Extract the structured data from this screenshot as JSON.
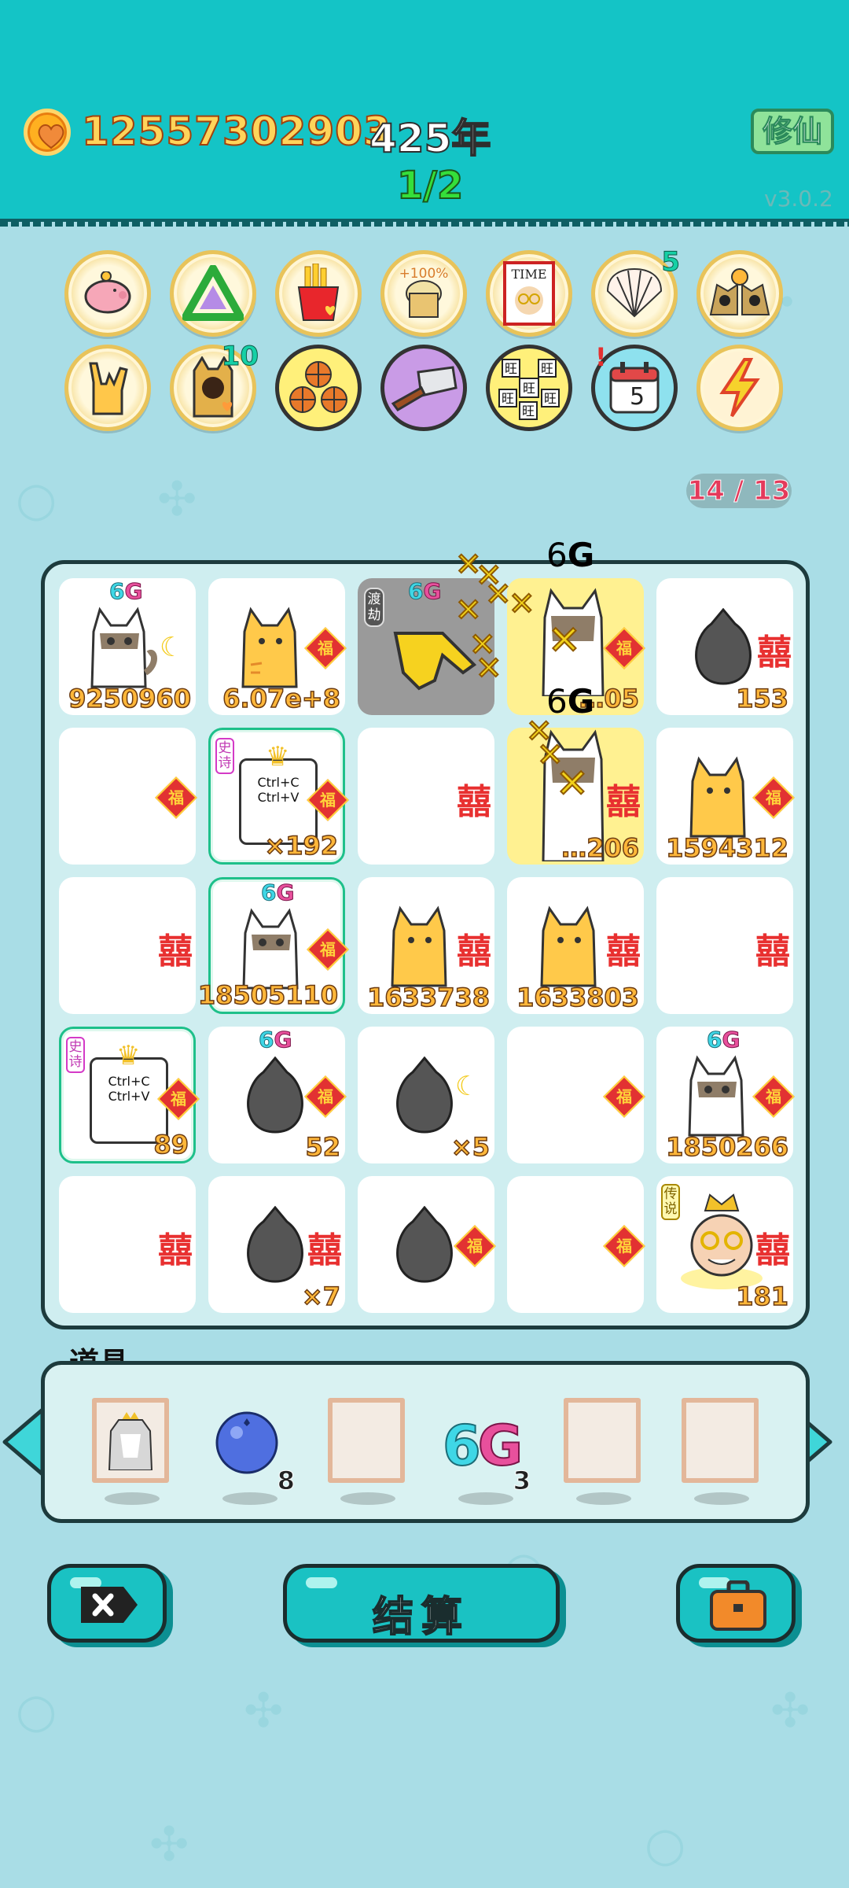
{
  "header": {
    "coins": "12557302903",
    "year": "425年",
    "round": "1/2",
    "cultivate_label": "修仙",
    "version": "v3.0.2"
  },
  "buffs": [
    {
      "name": "piggy-bank",
      "count": ""
    },
    {
      "name": "recycle",
      "count": ""
    },
    {
      "name": "fries",
      "count": ""
    },
    {
      "name": "bucket-plus-100",
      "label": "+100%",
      "count": ""
    },
    {
      "name": "time-magazine",
      "label": "TIME",
      "count": ""
    },
    {
      "name": "shell",
      "count": "5"
    },
    {
      "name": "golden-cats",
      "count": ""
    },
    {
      "name": "rock-hand",
      "count": ""
    },
    {
      "name": "cat-figure",
      "count": "10"
    },
    {
      "name": "basketballs",
      "count": ""
    },
    {
      "name": "cleaver",
      "count": ""
    },
    {
      "name": "wang-tiles",
      "label": "旺",
      "count": ""
    },
    {
      "name": "calendar",
      "label": "5",
      "count": "",
      "alert": "!"
    },
    {
      "name": "lightning",
      "count": ""
    }
  ],
  "counter": "14 / 13",
  "board": {
    "cells": [
      {
        "kind": "cat-white",
        "tag6g": true,
        "value": "9250960",
        "moon": true
      },
      {
        "kind": "cat-orange",
        "value": "6.07e+8",
        "fu": true
      },
      {
        "kind": "hand",
        "tag6g": true,
        "dujie": "渡劫",
        "gray": true
      },
      {
        "kind": "cat-white",
        "tag6g": true,
        "value": "…05",
        "yellow": true,
        "fu": true
      },
      {
        "kind": "trash",
        "value": "153",
        "xi": true
      },
      {
        "kind": "empty",
        "fu": true
      },
      {
        "kind": "ctrl",
        "epic": "史诗",
        "value": "×192",
        "fu": true
      },
      {
        "kind": "empty",
        "xi": true
      },
      {
        "kind": "cat-white",
        "tag6g": true,
        "value": "…206",
        "yellow": true,
        "xi": true
      },
      {
        "kind": "cat-orange",
        "value": "1594312",
        "fu": true
      },
      {
        "kind": "empty",
        "xi": true
      },
      {
        "kind": "cat-white",
        "tag6g": true,
        "value": "18505110",
        "epicframe": true,
        "fu": true
      },
      {
        "kind": "cat-orange",
        "value": "1633738",
        "xi": true
      },
      {
        "kind": "cat-orange",
        "value": "1633803",
        "xi": true
      },
      {
        "kind": "empty",
        "xi": true
      },
      {
        "kind": "ctrl",
        "epic": "史诗",
        "value": "89",
        "fu": true
      },
      {
        "kind": "trash",
        "tag6g": true,
        "value": "52",
        "fu": true
      },
      {
        "kind": "trash",
        "value": "×5",
        "moon": true
      },
      {
        "kind": "empty",
        "fu": true
      },
      {
        "kind": "cat-white",
        "tag6g": true,
        "value": "1850266",
        "fu": true
      },
      {
        "kind": "empty",
        "xi": true
      },
      {
        "kind": "trash",
        "value": "×7",
        "xi": true
      },
      {
        "kind": "trash",
        "fu": true
      },
      {
        "kind": "empty",
        "fu": true
      },
      {
        "kind": "grandpa",
        "legend": "传说",
        "value": "181",
        "xi": true
      }
    ],
    "ctrl_text": [
      "Ctrl+C",
      "Ctrl+V"
    ],
    "fu_char": "福",
    "xi_char": "囍",
    "tag6g_text": "6",
    "tag6g_g": "G"
  },
  "items": {
    "title": "道具",
    "list": [
      {
        "name": "husky-card",
        "count": ""
      },
      {
        "name": "blueberry",
        "count": "8"
      },
      {
        "name": "empty-frame",
        "count": ""
      },
      {
        "name": "6g",
        "label_6": "6",
        "label_g": "G",
        "count": "3"
      },
      {
        "name": "empty-frame",
        "count": ""
      },
      {
        "name": "empty-frame",
        "count": ""
      }
    ]
  },
  "buttons": {
    "settle_label": "结算"
  },
  "colors": {
    "header": "#14c4c6",
    "background": "#a9dde6",
    "gold_text": "#ffd45a",
    "accent_green": "#35df3a"
  }
}
